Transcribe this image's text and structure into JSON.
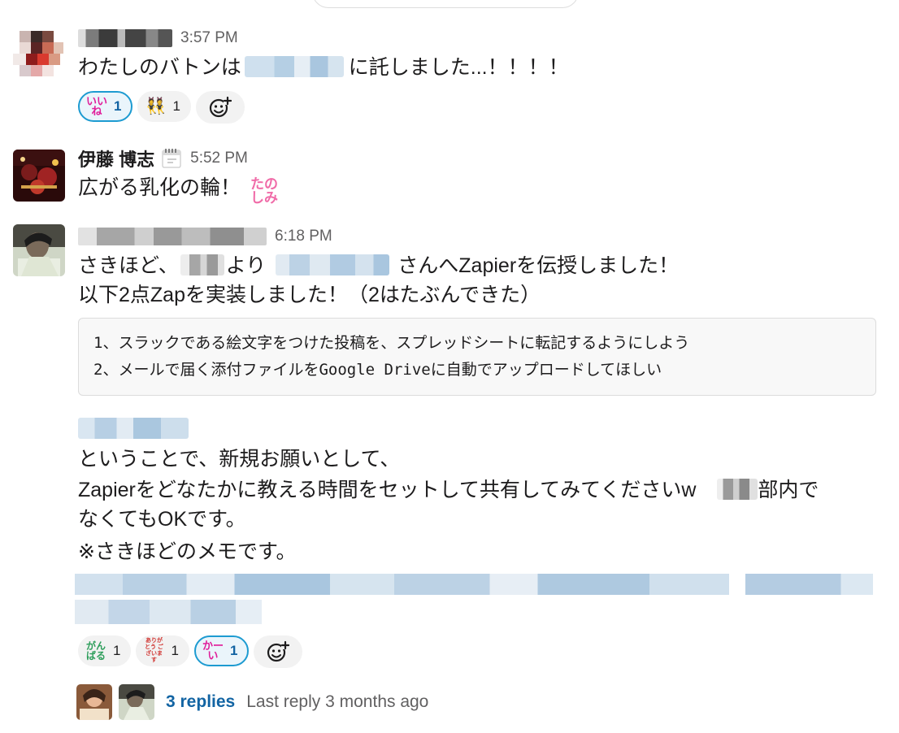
{
  "messages": [
    {
      "sender": "",
      "time": "3:57 PM",
      "text_before": "わたしのバトンは",
      "text_after": "に託しました...！！！！",
      "reactions": [
        {
          "emoji": "iine-emoji",
          "emoji_text": "いいね",
          "emoji_color": "#e01e9a",
          "count": "1",
          "selected": true
        },
        {
          "emoji": "dancers-emoji",
          "emoji_text": "👯",
          "emoji_color": "#d4a017",
          "count": "1",
          "selected": false
        }
      ]
    },
    {
      "sender": "伊藤 博志",
      "status_icon": "calendar-icon",
      "time": "5:52 PM",
      "text": "広がる乳化の輪！",
      "inline_emoji": "たの しみ",
      "inline_emoji_color": "#f06ba8"
    },
    {
      "sender": "",
      "time": "6:18 PM",
      "line1_before": "さきほど、",
      "line1_mid": "より",
      "line1_after": "さんへZapierを伝授しました！",
      "line2": "以下2点Zapを実装しました！（2はたぶんできた）",
      "code_lines": [
        "1、スラックである絵文字をつけた投稿を、スプレッドシートに転記するようにしよう",
        "2、メールで届く添付ファイルをGoogle Driveに自動でアップロードしてほしい"
      ],
      "line3": "ということで、新規お願いとして、",
      "line4_before": "Zapierをどなたかに教える時間をセットして共有してみてくださいw",
      "line4_after": "部内で",
      "line5": "なくてもOKです。",
      "line6": "※さきほどのメモです。",
      "reactions": [
        {
          "emoji": "ganbaru-emoji",
          "emoji_text": "がん ばる",
          "emoji_color": "#2e9e5b",
          "count": "1",
          "selected": false
        },
        {
          "emoji": "arigatou-emoji",
          "emoji_text": "ありがとう ございます",
          "emoji_color": "#d0312d",
          "count": "1",
          "selected": false
        },
        {
          "emoji": "kawaii-emoji",
          "emoji_text": "かーい",
          "emoji_color": "#e01e9a",
          "count": "1",
          "selected": true
        }
      ],
      "thread": {
        "reply_count": "3 replies",
        "last_reply": "Last reply 3 months ago"
      }
    }
  ],
  "colors": {
    "link": "#1264a3",
    "selected_border": "#1d9bd1",
    "muted": "#616061"
  }
}
